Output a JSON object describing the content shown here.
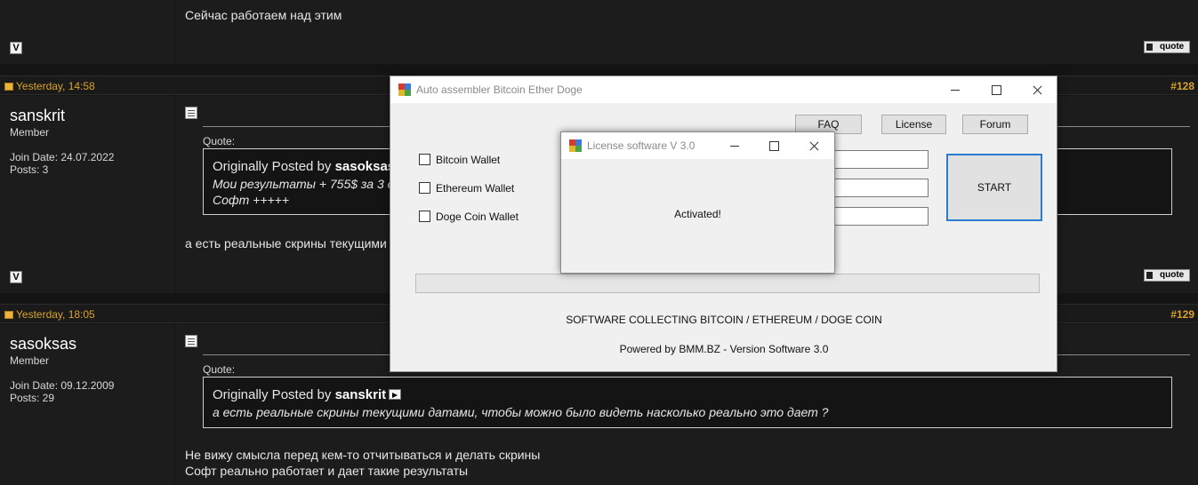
{
  "forum": {
    "top_post_text": "Сейчас работаем над этим",
    "quote_label": "quote",
    "v_label": "V",
    "posts": [
      {
        "date": "Yesterday, 14:58",
        "number": "#128",
        "username": "sanskrit",
        "user_title": "Member",
        "join_date": "Join Date: 24.07.2022",
        "posts_count": "Posts: 3",
        "quote_label": "Quote:",
        "quote_head_prefix": "Originally Posted by ",
        "quote_author": "sasoksas",
        "quote_lines": [
          "Мои результаты + 755$ за 3 д",
          "Софт +++++"
        ],
        "text_lines": [
          "а есть реальные скрины текущими"
        ]
      },
      {
        "date": "Yesterday, 18:05",
        "number": "#129",
        "username": "sasoksas",
        "user_title": "Member",
        "join_date": "Join Date: 09.12.2009",
        "posts_count": "Posts: 29",
        "quote_label": "Quote:",
        "quote_head_prefix": "Originally Posted by ",
        "quote_author": "sanskrit",
        "quote_lines": [
          "а есть реальные скрины текущими датами, чтобы можно было видеть насколько реально это дает ?"
        ],
        "text_lines": [
          "Не вижу смысла перед кем-то отчитываться и делать скрины",
          "Софт реально работает и дает такие результаты"
        ]
      }
    ]
  },
  "main_window": {
    "title": "Auto assembler Bitcoin  Ether Doge",
    "buttons": {
      "faq": "FAQ",
      "license": "License",
      "forum": "Forum",
      "start": "START"
    },
    "checkboxes": [
      {
        "label": "Bitcoin Wallet",
        "checked": false
      },
      {
        "label": "Ethereum Wallet",
        "checked": false
      },
      {
        "label": "Doge Coin Wallet",
        "checked": false
      }
    ],
    "progress": 0,
    "footer_line1": "SOFTWARE COLLECTING BITCOIN / ETHEREUM / DOGE COIN",
    "footer_line2": "Powered by BMM.BZ - Version Software 3.0"
  },
  "license_window": {
    "title": "License software V 3.0",
    "message": "Activated!"
  },
  "colors": {
    "forum_bg": "#1c1c1c",
    "header_accent": "#d9a32b",
    "start_border": "#2a7bd1"
  }
}
